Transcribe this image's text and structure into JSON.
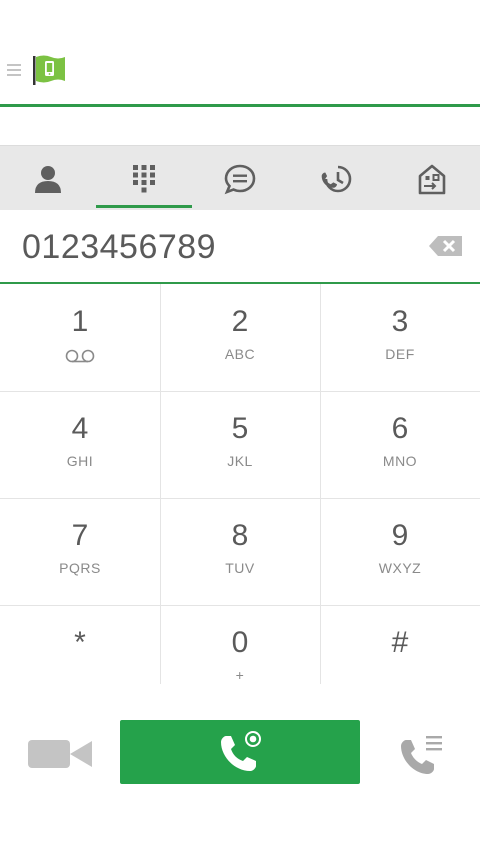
{
  "header": {
    "menu_icon": "hamburger-menu-icon",
    "logo_icon": "app-flag-phone-icon"
  },
  "tabs": [
    {
      "icon": "contact-person-icon",
      "selected": false
    },
    {
      "icon": "dialpad-grid-icon",
      "selected": true
    },
    {
      "icon": "chat-bubble-icon",
      "selected": false
    },
    {
      "icon": "call-history-clock-icon",
      "selected": false
    },
    {
      "icon": "building-transfer-icon",
      "selected": false
    }
  ],
  "dialer": {
    "number": "0123456789",
    "backspace_icon": "backspace-icon"
  },
  "keys": [
    {
      "digit": "1",
      "letters": "",
      "sub_icon": "voicemail-icon"
    },
    {
      "digit": "2",
      "letters": "ABC"
    },
    {
      "digit": "3",
      "letters": "DEF"
    },
    {
      "digit": "4",
      "letters": "GHI"
    },
    {
      "digit": "5",
      "letters": "JKL"
    },
    {
      "digit": "6",
      "letters": "MNO"
    },
    {
      "digit": "7",
      "letters": "PQRS"
    },
    {
      "digit": "8",
      "letters": "TUV"
    },
    {
      "digit": "9",
      "letters": "WXYZ"
    },
    {
      "digit": "*",
      "letters": ""
    },
    {
      "digit": "0",
      "letters": "+"
    },
    {
      "digit": "#",
      "letters": ""
    }
  ],
  "actions": {
    "video_icon": "video-camera-icon",
    "call_icon": "phone-call-icon",
    "call_log_icon": "call-list-icon"
  },
  "colors": {
    "accent": "#2f9a4a",
    "call_button": "#25a24b",
    "icon_gray": "#5f5f5f",
    "tab_background": "#e8e8e8"
  }
}
